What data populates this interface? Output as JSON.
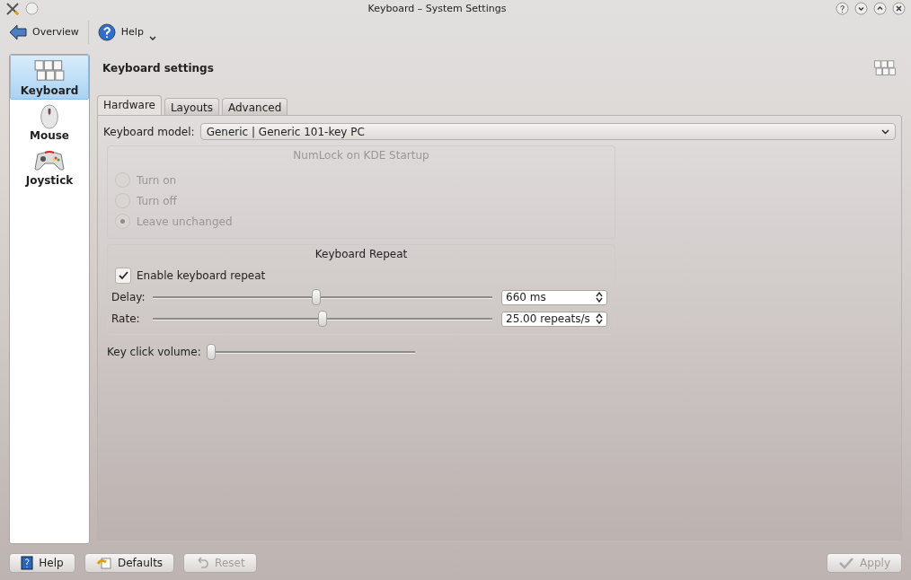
{
  "window": {
    "title": "Keyboard – System Settings"
  },
  "toolbar": [
    {
      "kind": "back",
      "label": "Overview"
    },
    {
      "kind": "help",
      "label": "Help"
    }
  ],
  "sidebar": {
    "items": [
      {
        "kind": "keyboard",
        "label": "Keyboard",
        "selected": true
      },
      {
        "kind": "mouse",
        "label": "Mouse",
        "selected": false
      },
      {
        "kind": "joystick",
        "label": "Joystick",
        "selected": false
      }
    ]
  },
  "heading": "Keyboard settings",
  "tabs": [
    {
      "label": "Hardware",
      "selected": true
    },
    {
      "label": "Layouts",
      "selected": false
    },
    {
      "label": "Advanced",
      "selected": false
    }
  ],
  "keyboard_model": {
    "label": "Keyboard model:",
    "value": "Generic | Generic 101-key PC"
  },
  "numlock": {
    "title": "NumLock on KDE Startup",
    "disabled": true,
    "options": [
      {
        "label": "Turn on",
        "selected": false
      },
      {
        "label": "Turn off",
        "selected": false
      },
      {
        "label": "Leave unchanged",
        "selected": true
      }
    ]
  },
  "repeat": {
    "title": "Keyboard Repeat",
    "enable": {
      "label": "Enable keyboard repeat",
      "checked": true
    },
    "sliders": [
      {
        "label": "Delay:",
        "level": 0.48,
        "value": "660 ms"
      },
      {
        "label": "Rate:",
        "level": 0.5,
        "value": "25.00 repeats/s"
      }
    ]
  },
  "key_click": {
    "label": "Key click volume:",
    "level": 0
  },
  "buttons": [
    {
      "kind": "help",
      "label": "Help",
      "disabled": false
    },
    {
      "kind": "defaults",
      "label": "Defaults",
      "disabled": false
    },
    {
      "kind": "reset",
      "label": "Reset",
      "disabled": true
    },
    {
      "kind": "apply",
      "label": "Apply",
      "disabled": true
    }
  ]
}
